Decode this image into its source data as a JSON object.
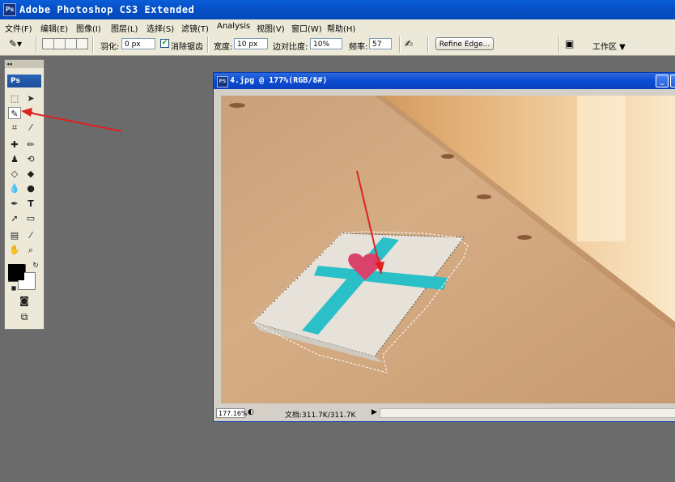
{
  "app": {
    "title": "Adobe Photoshop CS3 Extended",
    "badge": "Ps"
  },
  "menu": [
    "文件(F)",
    "编辑(E)",
    "图像(I)",
    "图层(L)",
    "选择(S)",
    "滤镜(T)",
    "Analysis",
    "视图(V)",
    "窗口(W)",
    "帮助(H)"
  ],
  "options": {
    "feather_label": "羽化:",
    "feather_value": "0 px",
    "antialias_label": "消除锯齿",
    "width_label": "宽度:",
    "width_value": "10 px",
    "contrast_label": "边对比度:",
    "contrast_value": "10%",
    "frequency_label": "频率:",
    "frequency_value": "57",
    "refine_edge": "Refine Edge...",
    "workspace": "工作区 ▼"
  },
  "tools_panel": {
    "logo": "Ps",
    "grip": "◂◂"
  },
  "document": {
    "title": "4.jpg @ 177%(RGB/8#)",
    "zoom": "177.16%",
    "doc_info": "文档:311.7K/311.7K"
  },
  "colors": {
    "accent_arrow": "#e02020",
    "title_blue": "#0a5ed8",
    "ribbon": "#2bbfc7",
    "heart": "#d9436b"
  }
}
